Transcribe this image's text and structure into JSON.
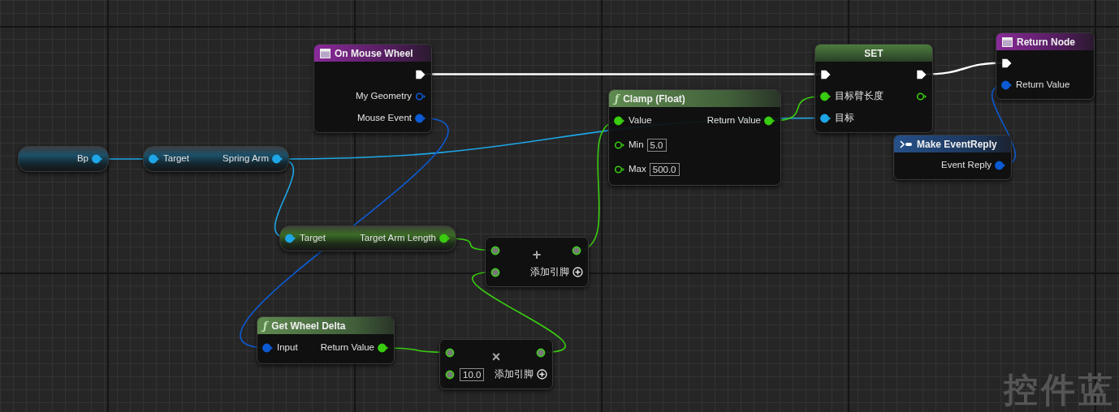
{
  "nodes": [
    {
      "kind": "getter",
      "rows": [
        {
          "out": {
            "kind": "object",
            "label": "Bp",
            "connected": true
          }
        }
      ]
    },
    {
      "kind": "getter",
      "rows": [
        {
          "in": {
            "kind": "object",
            "label": "Target",
            "connected": true
          },
          "out": {
            "kind": "object",
            "label": "Spring Arm",
            "connected": true
          }
        }
      ]
    },
    {
      "kind": "event",
      "title": "On Mouse Wheel",
      "rows": [
        {
          "out": {
            "kind": "exec",
            "connected": true
          }
        },
        {
          "out": {
            "kind": "struct",
            "label": "My Geometry",
            "connected": false
          }
        },
        {
          "out": {
            "kind": "struct",
            "label": "Mouse Event",
            "connected": true
          }
        }
      ]
    },
    {
      "kind": "getter",
      "rows": [
        {
          "in": {
            "kind": "object",
            "label": "Target",
            "connected": true
          },
          "out": {
            "kind": "float",
            "label": "Target Arm Length",
            "connected": true
          }
        }
      ]
    },
    {
      "kind": "function",
      "glyph": "ƒ",
      "title": "Get Wheel Delta",
      "rows": [
        {
          "in": {
            "kind": "struct",
            "label": "Input",
            "connected": true
          },
          "out": {
            "kind": "float",
            "label": "Return Value",
            "connected": true
          }
        }
      ]
    },
    {
      "kind": "operator",
      "symbol": "+",
      "add_pin": "添加引脚",
      "rows": [
        {
          "in": {
            "kind": "wildcard"
          },
          "out": {
            "kind": "wildcard"
          }
        },
        {
          "in": {
            "kind": "wildcard"
          }
        }
      ]
    },
    {
      "kind": "operator",
      "symbol": "×",
      "add_pin": "添加引脚",
      "rows": [
        {
          "in": {
            "kind": "wildcard"
          },
          "out": {
            "kind": "wildcard"
          }
        },
        {
          "in": {
            "kind": "wildcard",
            "default": "10.0"
          }
        }
      ]
    },
    {
      "kind": "function",
      "glyph": "ƒ",
      "title": "Clamp (Float)",
      "rows": [
        {
          "in": {
            "kind": "float",
            "label": "Value",
            "connected": true
          },
          "out": {
            "kind": "float",
            "label": "Return Value",
            "connected": true
          }
        },
        {
          "in": {
            "kind": "float",
            "label": "Min",
            "connected": false,
            "default": "5.0"
          }
        },
        {
          "in": {
            "kind": "float",
            "label": "Max",
            "connected": false,
            "default": "500.0"
          }
        }
      ]
    },
    {
      "kind": "set",
      "title": "SET",
      "rows": [
        {
          "in": {
            "kind": "exec",
            "connected": true
          },
          "out": {
            "kind": "exec",
            "connected": true
          }
        },
        {
          "in": {
            "kind": "float",
            "label": "目标臂长度",
            "connected": true
          },
          "out": {
            "kind": "float",
            "connected": false
          }
        },
        {
          "in": {
            "kind": "object",
            "label": "目标",
            "connected": true
          }
        }
      ]
    },
    {
      "kind": "return",
      "title": "Return Node",
      "rows": [
        {
          "in": {
            "kind": "exec",
            "connected": true
          }
        },
        {
          "in": {
            "kind": "struct",
            "label": "Return Value",
            "connected": true
          }
        }
      ]
    },
    {
      "kind": "make",
      "title": "Make EventReply",
      "rows": [
        {
          "out": {
            "kind": "struct",
            "label": "Event Reply",
            "connected": true
          }
        }
      ]
    }
  ],
  "graph_label": "控件蓝"
}
